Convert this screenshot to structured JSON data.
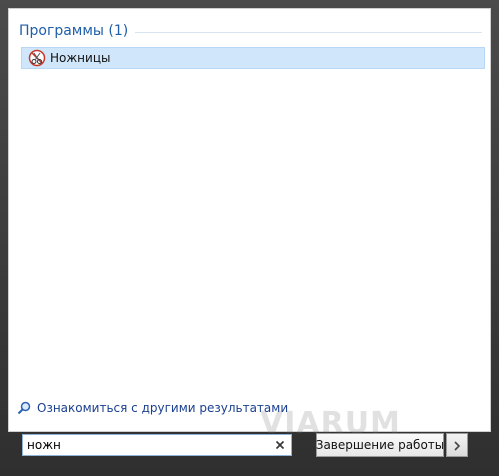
{
  "programs_section": {
    "title": "Программы (1)",
    "items": [
      {
        "label": "Ножницы",
        "icon": "scissors-app-icon"
      }
    ]
  },
  "more_results": {
    "label": "Ознакомиться с другими результатами",
    "icon": "search-magnifier-icon"
  },
  "search": {
    "value": "ножн",
    "clear_icon": "clear-x-icon"
  },
  "shutdown": {
    "label": "Завершение работы",
    "arrow_icon": "chevron-right-icon"
  },
  "watermark": {
    "text": "VIARUM"
  },
  "colors": {
    "section_title": "#1f5fa8",
    "selection_bg": "#cfe6fb",
    "link": "#1a3f8f",
    "frame": "#3a3a3a"
  }
}
